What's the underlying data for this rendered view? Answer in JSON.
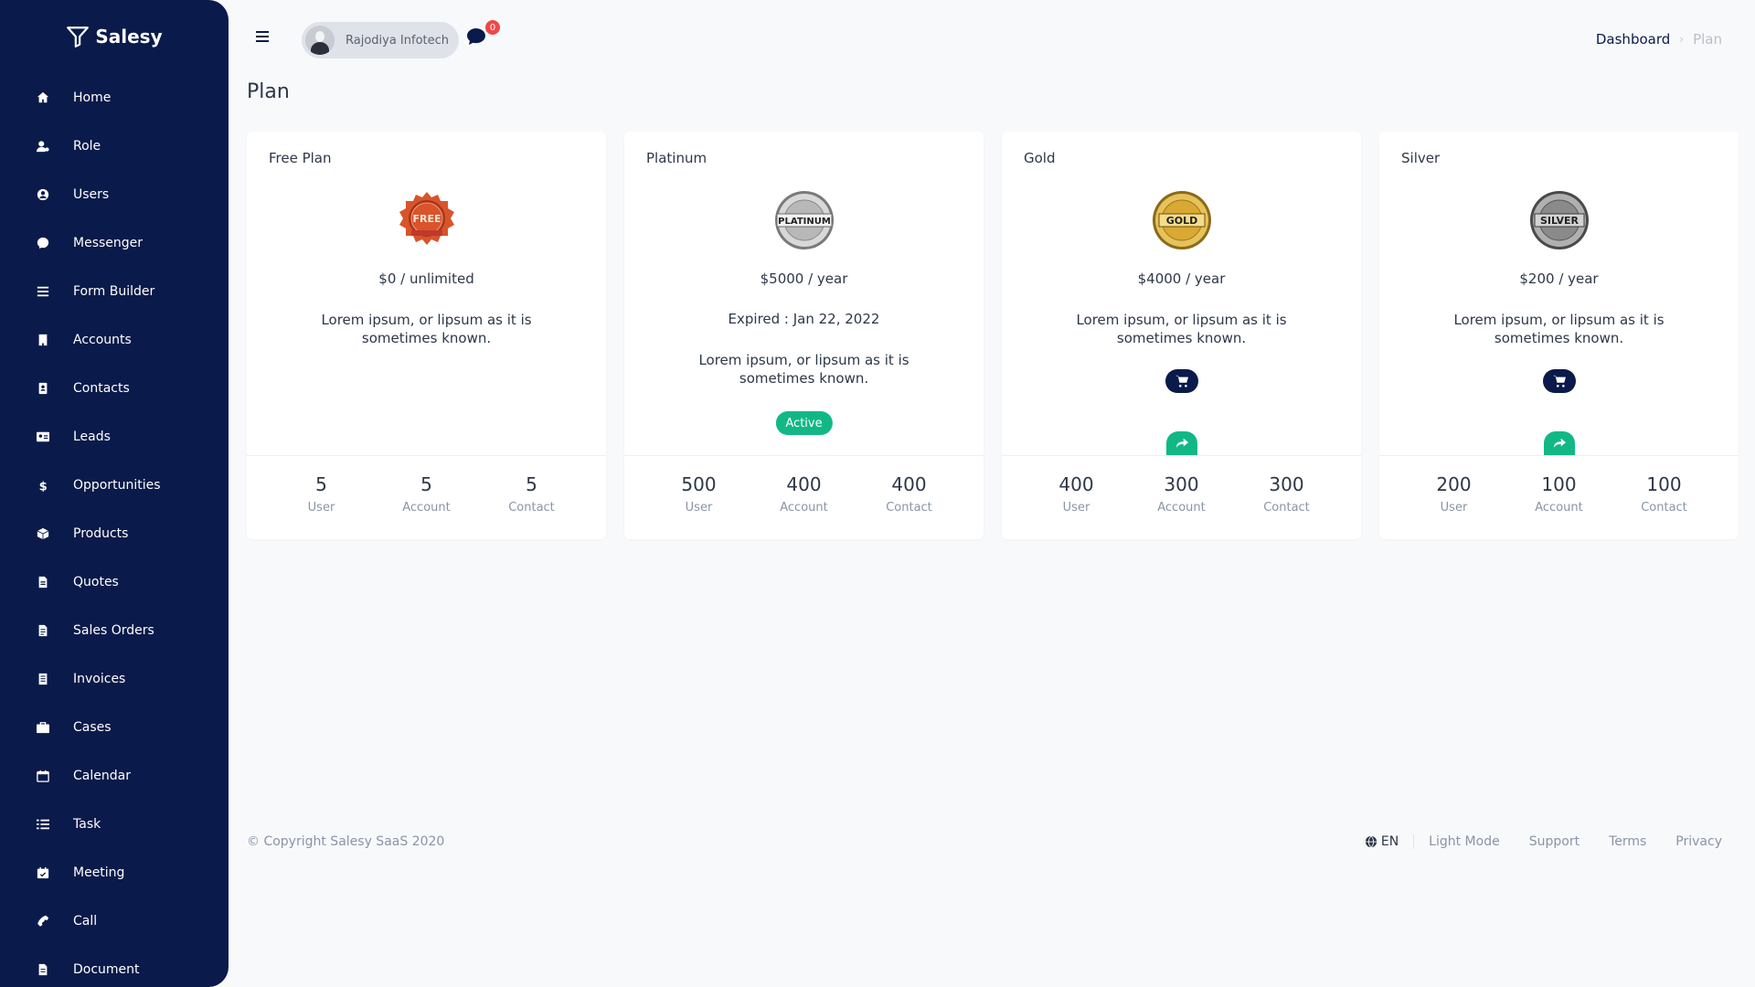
{
  "brand": {
    "name": "Salesy"
  },
  "sidebar": {
    "items": [
      {
        "label": "Home",
        "icon": "home-icon"
      },
      {
        "label": "Role",
        "icon": "user-cog-icon"
      },
      {
        "label": "Users",
        "icon": "user-circle-icon"
      },
      {
        "label": "Messenger",
        "icon": "messenger-icon"
      },
      {
        "label": "Form Builder",
        "icon": "list-icon"
      },
      {
        "label": "Accounts",
        "icon": "building-icon"
      },
      {
        "label": "Contacts",
        "icon": "contact-book-icon"
      },
      {
        "label": "Leads",
        "icon": "id-card-icon"
      },
      {
        "label": "Opportunities",
        "icon": "dollar-icon"
      },
      {
        "label": "Products",
        "icon": "box-icon"
      },
      {
        "label": "Quotes",
        "icon": "file-invoice-icon"
      },
      {
        "label": "Sales Orders",
        "icon": "file-lines-icon"
      },
      {
        "label": "Invoices",
        "icon": "receipt-icon"
      },
      {
        "label": "Cases",
        "icon": "briefcase-icon"
      },
      {
        "label": "Calendar",
        "icon": "calendar-icon"
      },
      {
        "label": "Task",
        "icon": "task-list-icon"
      },
      {
        "label": "Meeting",
        "icon": "calendar-check-icon"
      },
      {
        "label": "Call",
        "icon": "phone-icon"
      },
      {
        "label": "Document",
        "icon": "document-icon"
      }
    ]
  },
  "header": {
    "user_name": "Rajodiya Infotech",
    "message_count": "0",
    "breadcrumb": {
      "home": "Dashboard",
      "current": "Plan"
    }
  },
  "page": {
    "title": "Plan"
  },
  "plans": [
    {
      "name": "Free Plan",
      "badge_text": "FREE",
      "badge_color": "#d9542b",
      "price": "$0 / unlimited",
      "expired": "",
      "description": "Lorem ipsum, or lipsum as it is sometimes known.",
      "status": "",
      "stats": [
        {
          "value": "5",
          "label": "User"
        },
        {
          "value": "5",
          "label": "Account"
        },
        {
          "value": "5",
          "label": "Contact"
        }
      ]
    },
    {
      "name": "Platinum",
      "badge_text": "PLATINUM",
      "badge_color": "#b8b8b8",
      "price": "$5000 / year",
      "expired": "Expired : Jan 22, 2022",
      "description": "Lorem ipsum, or lipsum as it is sometimes known.",
      "status": "Active",
      "stats": [
        {
          "value": "500",
          "label": "User"
        },
        {
          "value": "400",
          "label": "Account"
        },
        {
          "value": "400",
          "label": "Contact"
        }
      ]
    },
    {
      "name": "Gold",
      "badge_text": "GOLD",
      "badge_color": "#d9a934",
      "price": "$4000 / year",
      "expired": "",
      "description": "Lorem ipsum, or lipsum as it is sometimes known.",
      "status": "",
      "stats": [
        {
          "value": "400",
          "label": "User"
        },
        {
          "value": "300",
          "label": "Account"
        },
        {
          "value": "300",
          "label": "Contact"
        }
      ]
    },
    {
      "name": "Silver",
      "badge_text": "SILVER",
      "badge_color": "#9a9a9a",
      "price": "$200 / year",
      "expired": "",
      "description": "Lorem ipsum, or lipsum as it is sometimes known.",
      "status": "",
      "stats": [
        {
          "value": "200",
          "label": "User"
        },
        {
          "value": "100",
          "label": "Account"
        },
        {
          "value": "100",
          "label": "Contact"
        }
      ]
    }
  ],
  "footer": {
    "copyright": "© Copyright Salesy SaaS 2020",
    "language": "EN",
    "links": [
      "Light Mode",
      "Support",
      "Terms",
      "Privacy"
    ]
  },
  "colors": {
    "sidebar_bg": "#0a1a4a",
    "accent_green": "#11b886",
    "notification_red": "#f04848"
  }
}
